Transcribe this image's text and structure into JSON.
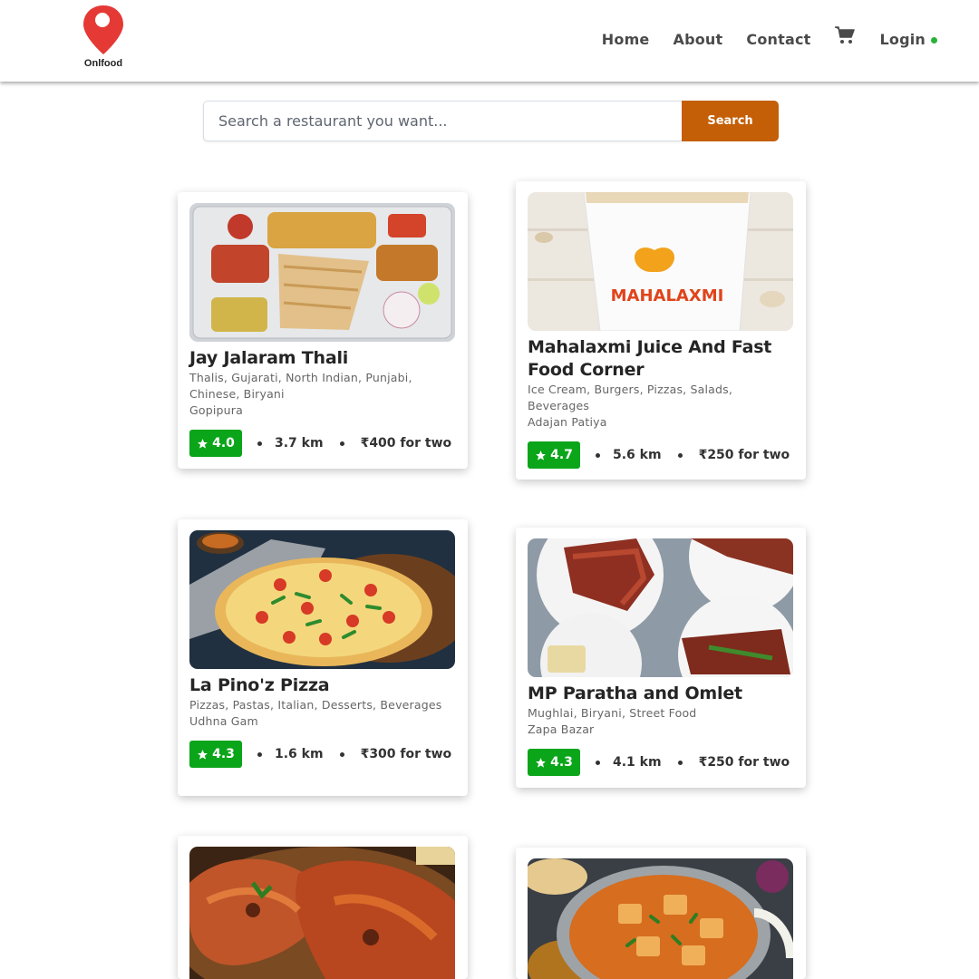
{
  "header": {
    "logo_text": "Onlfood",
    "nav": {
      "home": "Home",
      "about": "About",
      "contact": "Contact",
      "cart_icon": "cart-icon",
      "login": "Login"
    },
    "colors": {
      "logo_pin": "#e53935",
      "online_dot": "#27b33a"
    }
  },
  "search": {
    "placeholder": "Search a restaurant you want...",
    "button_label": "Search",
    "button_color": "#c45f07"
  },
  "restaurants": [
    {
      "name": "Jay Jalaram Thali",
      "cuisines": "Thalis, Gujarati, North Indian, Punjabi, Chinese, Biryani",
      "area": "Gopipura",
      "rating": "4.0",
      "distance": "3.7 km",
      "price": "₹400 for two",
      "image": "thali-photo"
    },
    {
      "name": "Mahalaxmi Juice And Fast Food Corner",
      "cuisines": "Ice Cream, Burgers, Pizzas, Salads, Beverages",
      "area": "Adajan Patiya",
      "rating": "4.7",
      "distance": "5.6 km",
      "price": "₹250 for two",
      "image": "juice-cup-photo",
      "image_text": "MAHALAXMI"
    },
    {
      "name": "La Pino'z Pizza",
      "cuisines": "Pizzas, Pastas, Italian, Desserts, Beverages",
      "area": "Udhna Gam",
      "rating": "4.3",
      "distance": "1.6 km",
      "price": "₹300 for two",
      "image": "pizza-photo"
    },
    {
      "name": "MP Paratha and Omlet",
      "cuisines": "Mughlai, Biryani, Street Food",
      "area": "Zapa Bazar",
      "rating": "4.3",
      "distance": "4.1 km",
      "price": "₹250 for two",
      "image": "paratha-photo"
    },
    {
      "image": "tandoori-chicken-photo"
    },
    {
      "image": "paneer-curry-photo"
    }
  ],
  "rating_color": "#0ba51a"
}
